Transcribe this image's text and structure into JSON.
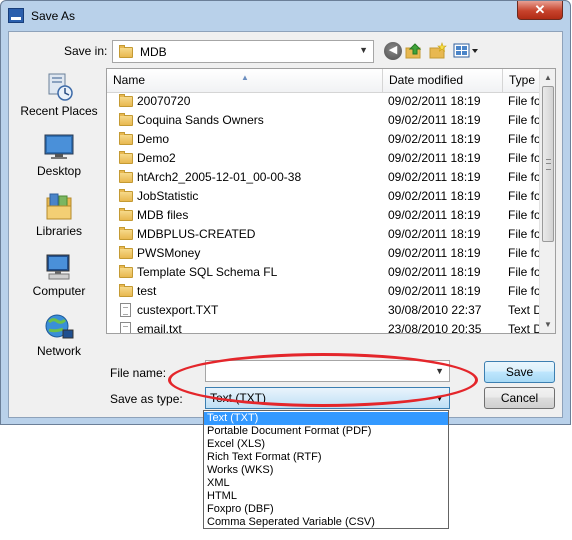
{
  "window": {
    "title": "Save As",
    "close_glyph": "✕"
  },
  "toolbar": {
    "save_in_label": "Save in:",
    "save_in_value": "MDB",
    "icons": [
      "back-icon",
      "up-folder-icon",
      "new-folder-icon",
      "views-menu-icon"
    ]
  },
  "places": [
    {
      "label": "Recent Places",
      "icon": "recent-places-icon"
    },
    {
      "label": "Desktop",
      "icon": "desktop-icon"
    },
    {
      "label": "Libraries",
      "icon": "libraries-icon"
    },
    {
      "label": "Computer",
      "icon": "computer-icon"
    },
    {
      "label": "Network",
      "icon": "network-icon"
    }
  ],
  "columns": {
    "name": "Name",
    "date": "Date modified",
    "type": "Type"
  },
  "files": [
    {
      "name": "20070720",
      "date": "09/02/2011 18:19",
      "type": "File fol",
      "kind": "folder"
    },
    {
      "name": "Coquina Sands Owners",
      "date": "09/02/2011 18:19",
      "type": "File fol",
      "kind": "folder"
    },
    {
      "name": "Demo",
      "date": "09/02/2011 18:19",
      "type": "File fol",
      "kind": "folder"
    },
    {
      "name": "Demo2",
      "date": "09/02/2011 18:19",
      "type": "File fol",
      "kind": "folder"
    },
    {
      "name": "htArch2_2005-12-01_00-00-38",
      "date": "09/02/2011 18:19",
      "type": "File fol",
      "kind": "folder"
    },
    {
      "name": "JobStatistic",
      "date": "09/02/2011 18:19",
      "type": "File fol",
      "kind": "folder"
    },
    {
      "name": "MDB files",
      "date": "09/02/2011 18:19",
      "type": "File fol",
      "kind": "folder"
    },
    {
      "name": "MDBPLUS-CREATED",
      "date": "09/02/2011 18:19",
      "type": "File fol",
      "kind": "folder"
    },
    {
      "name": "PWSMoney",
      "date": "09/02/2011 18:19",
      "type": "File fol",
      "kind": "folder"
    },
    {
      "name": "Template SQL Schema FL",
      "date": "09/02/2011 18:19",
      "type": "File fol",
      "kind": "folder"
    },
    {
      "name": "test",
      "date": "09/02/2011 18:19",
      "type": "File fol",
      "kind": "folder"
    },
    {
      "name": "custexport.TXT",
      "date": "30/08/2010 22:37",
      "type": "Text Do",
      "kind": "file"
    },
    {
      "name": "email.txt",
      "date": "23/08/2010 20:35",
      "type": "Text Do",
      "kind": "file"
    }
  ],
  "form": {
    "file_name_label": "File name:",
    "file_name_value": "",
    "save_as_type_label": "Save as type:",
    "save_as_type_value": "Text (TXT)"
  },
  "buttons": {
    "save": "Save",
    "cancel": "Cancel"
  },
  "type_options": [
    "Text (TXT)",
    "Portable Document Format (PDF)",
    "Excel (XLS)",
    "Rich Text Format (RTF)",
    "Works (WKS)",
    "XML",
    "HTML",
    "Foxpro (DBF)",
    "Comma Seperated Variable (CSV)"
  ],
  "selected_option_index": 0,
  "colors": {
    "highlight_ring": "#e4262b",
    "selection": "#3399ff",
    "frame": "#b9d1ea"
  }
}
